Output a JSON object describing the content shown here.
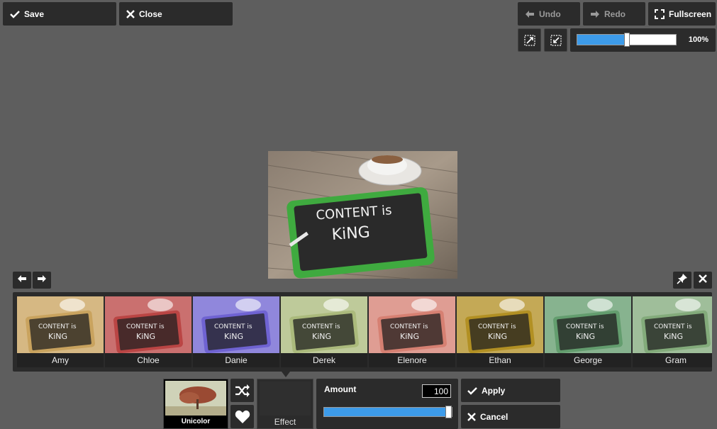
{
  "toolbar": {
    "save_label": "Save",
    "close_label": "Close",
    "undo_label": "Undo",
    "redo_label": "Redo",
    "fullscreen_label": "Fullscreen"
  },
  "zoom": {
    "value_text": "100%",
    "slider_fraction": 0.5
  },
  "canvas": {
    "image_text_line1": "CONTENT is",
    "image_text_line2": "KiNG"
  },
  "filters": [
    {
      "name": "Amy",
      "tint": "#c8a15a"
    },
    {
      "name": "Chloe",
      "tint": "#b8403f"
    },
    {
      "name": "Danie",
      "tint": "#6b5fd0"
    },
    {
      "name": "Derek",
      "tint": "#a8b879"
    },
    {
      "name": "Elenore",
      "tint": "#d57d6f"
    },
    {
      "name": "Ethan",
      "tint": "#b08d1e"
    },
    {
      "name": "George",
      "tint": "#5f9a6a"
    },
    {
      "name": "Gram",
      "tint": "#7fa878"
    }
  ],
  "effect_panel": {
    "preset_label": "Unicolor",
    "effect_label": "Effect",
    "amount_label": "Amount",
    "amount_value": "100",
    "amount_fraction": 1.0,
    "apply_label": "Apply",
    "cancel_label": "Cancel"
  },
  "colors": {
    "accent": "#3d9be9",
    "panel": "#2b2b2b",
    "background": "#5e5e5e"
  }
}
